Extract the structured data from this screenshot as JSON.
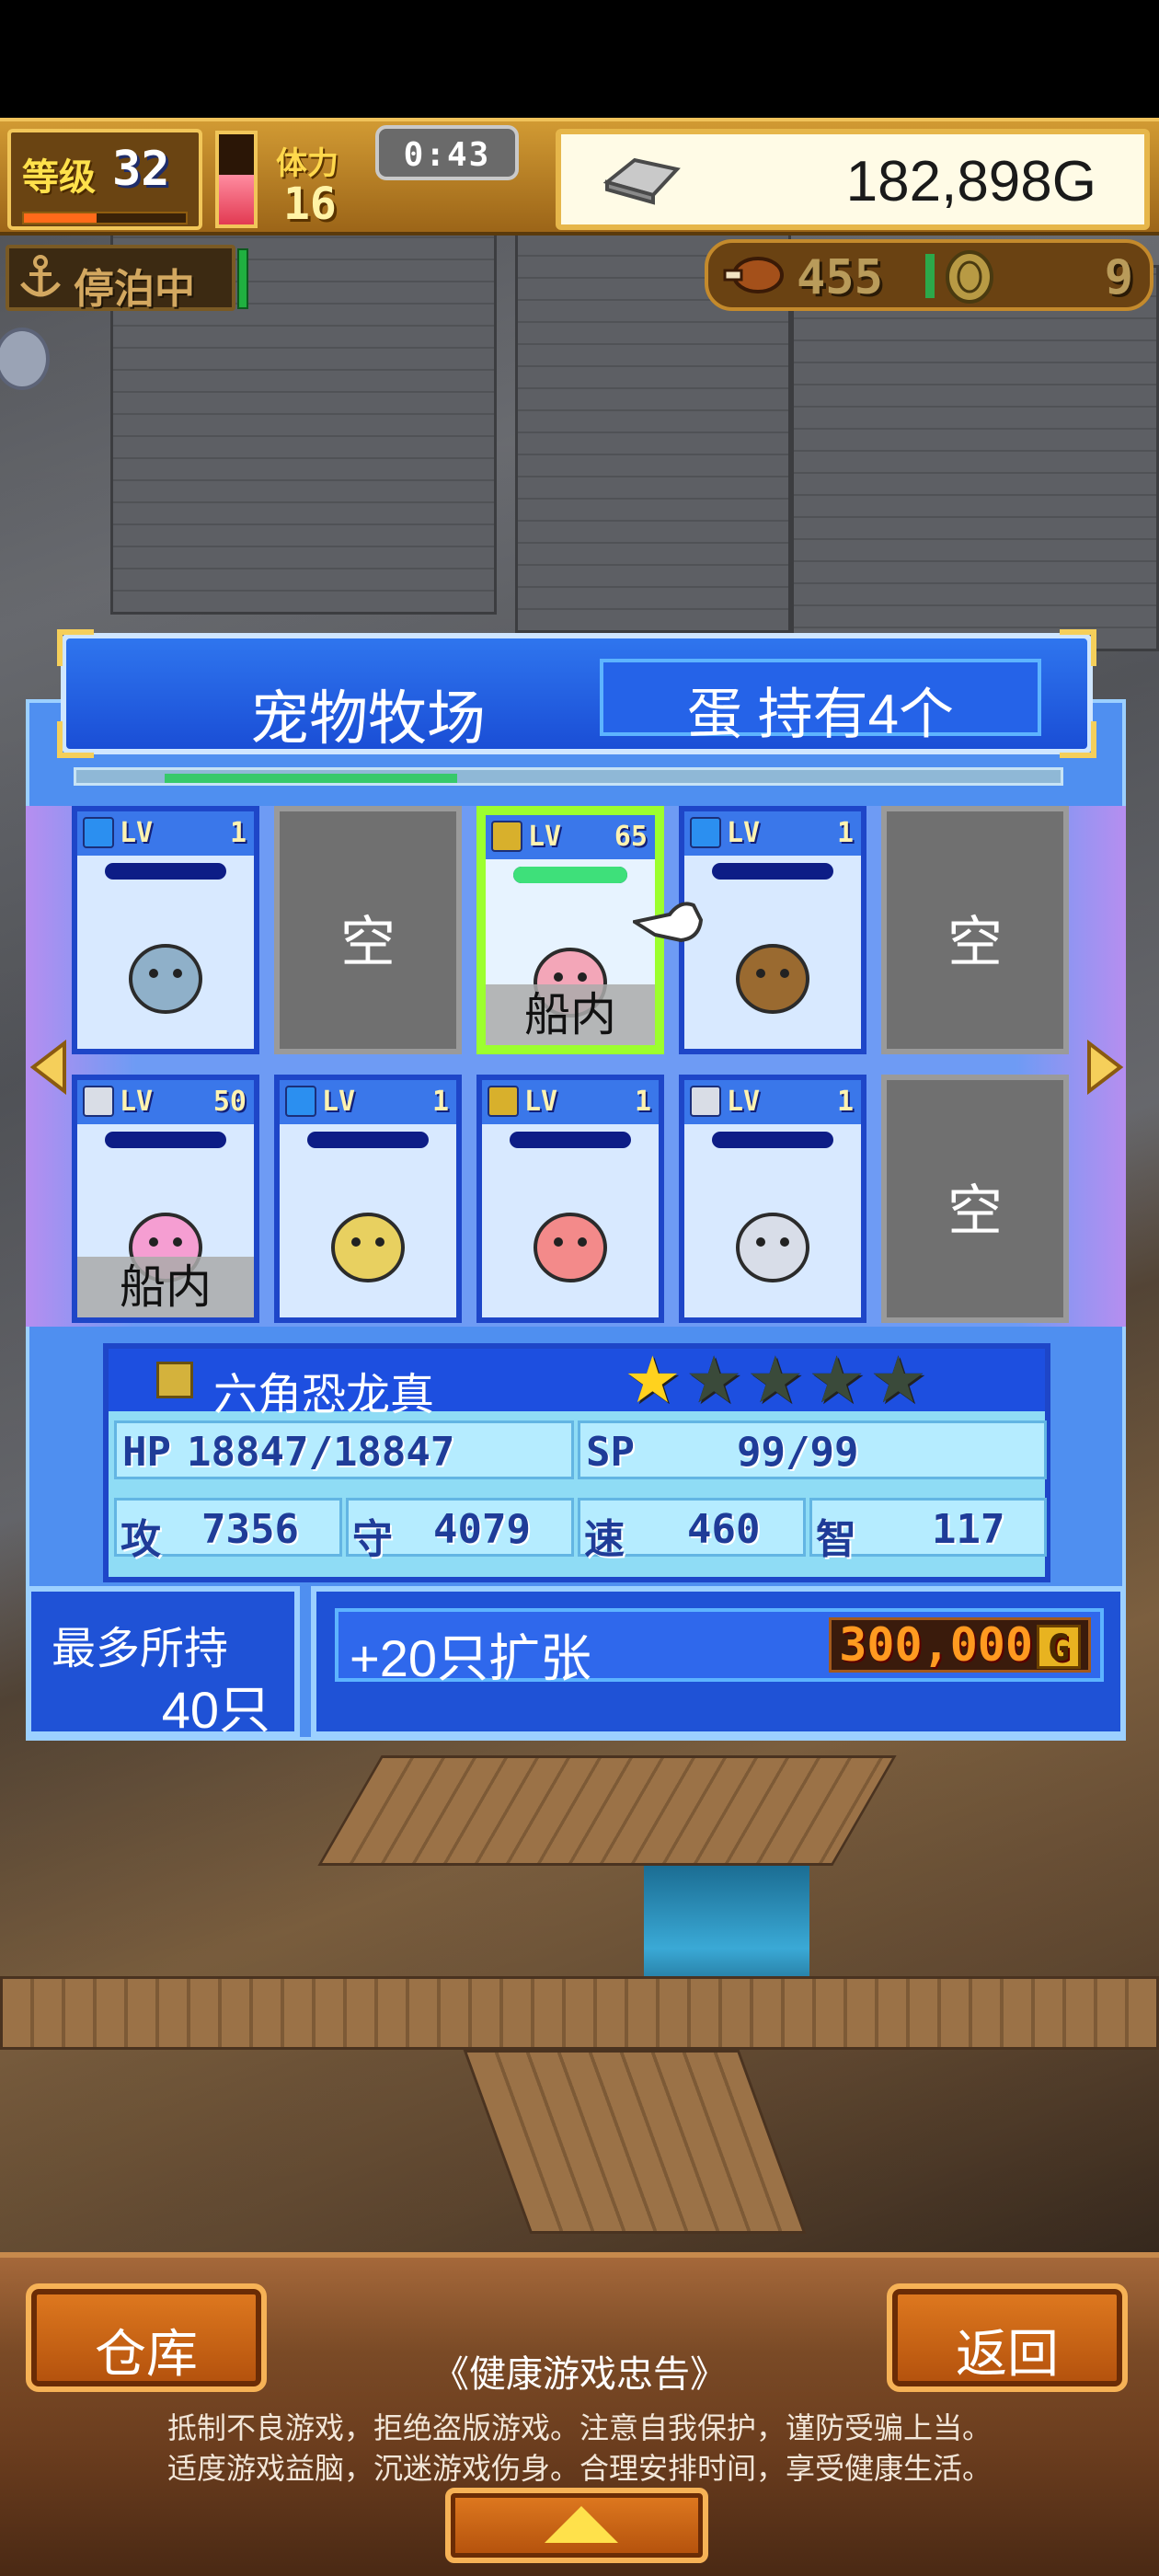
{
  "hud": {
    "level_label": "等级",
    "level": "32",
    "exp_fraction": 0.45,
    "stamina_fraction": 0.55,
    "stamina_label": "体力",
    "stamina": "16",
    "timer": "0:43",
    "gold": "182,898G"
  },
  "status": {
    "anchor_text": "停泊中",
    "food": "455",
    "coins": "9"
  },
  "ranch": {
    "title": "宠物牧场",
    "eggs": "蛋 持有4个",
    "scroll_fraction": 0.3,
    "lv_prefix": "LV",
    "empty_label": "空",
    "slots": [
      {
        "type": "pet",
        "element": "water",
        "level": "1",
        "hp_fraction": 0.0,
        "tag": ""
      },
      {
        "type": "empty"
      },
      {
        "type": "pet",
        "element": "thunder",
        "level": "65",
        "hp_fraction": 1.0,
        "tag": "船内",
        "selected": true
      },
      {
        "type": "pet",
        "element": "water",
        "level": "1",
        "hp_fraction": 0.0,
        "tag": ""
      },
      {
        "type": "empty"
      },
      {
        "type": "pet",
        "element": "neutral",
        "level": "50",
        "hp_fraction": 0.0,
        "tag": "船内"
      },
      {
        "type": "pet",
        "element": "water",
        "level": "1",
        "hp_fraction": 0.0,
        "tag": ""
      },
      {
        "type": "pet",
        "element": "thunder",
        "level": "1",
        "hp_fraction": 0.0,
        "tag": ""
      },
      {
        "type": "pet",
        "element": "neutral",
        "level": "1",
        "hp_fraction": 0.0,
        "tag": ""
      },
      {
        "type": "empty"
      }
    ]
  },
  "selected_pet": {
    "name": "六角恐龙真",
    "stars_filled": 1,
    "stars_total": 5,
    "hp_label": "HP",
    "hp": "18847/18847",
    "sp_label": "SP",
    "sp": "99/99",
    "atk_label": "攻",
    "atk": "7356",
    "def_label": "守",
    "def": "4079",
    "spd_label": "速",
    "spd": "460",
    "int_label": "智",
    "int": "117"
  },
  "capacity": {
    "label": "最多所持",
    "value": "40只",
    "expand_label": "+20只扩张",
    "expand_cost": "300,000",
    "cost_unit": "G"
  },
  "bottom": {
    "warehouse": "仓库",
    "back": "返回",
    "notice_title": "《健康游戏忠告》",
    "notice_line1": "抵制不良游戏，拒绝盗版游戏。注意自我保护，谨防受骗上当。",
    "notice_line2": "适度游戏益脑，沉迷游戏伤身。合理安排时间，享受健康生活。"
  },
  "colors": {
    "water": "#2b8ff0",
    "thunder": "#d8b02c",
    "neutral": "#d9dde6",
    "accent": "#1d4fe0",
    "star_on": "#ffd21e",
    "star_off": "#3a4a3a"
  }
}
